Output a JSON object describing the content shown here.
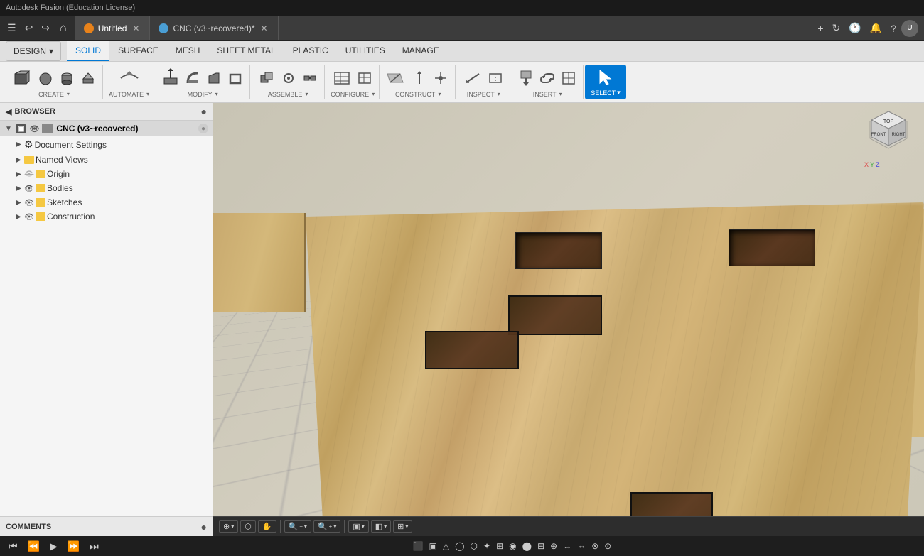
{
  "titlebar": {
    "text": "Autodesk Fusion (Education License)"
  },
  "tabs": [
    {
      "id": "untitled",
      "label": "Untitled",
      "icon_color": "orange",
      "active": true
    },
    {
      "id": "cnc",
      "label": "CNC (v3~recovered)*",
      "icon_color": "blue",
      "active": false
    }
  ],
  "tab_actions": [
    "+",
    "↻",
    "🕐",
    "🔔",
    "?"
  ],
  "ribbon": {
    "design_label": "DESIGN",
    "tabs": [
      "SOLID",
      "SURFACE",
      "MESH",
      "SHEET METAL",
      "PLASTIC",
      "UTILITIES",
      "MANAGE"
    ],
    "active_tab": "SOLID",
    "groups": [
      {
        "label": "CREATE",
        "has_arrow": true,
        "icons": [
          "⊞",
          "◻",
          "◯",
          "⬡"
        ]
      },
      {
        "label": "AUTOMATE",
        "has_arrow": true,
        "icons": [
          "✂"
        ]
      },
      {
        "label": "MODIFY",
        "has_arrow": true,
        "icons": [
          "◈",
          "◉",
          "▣",
          "⊟"
        ]
      },
      {
        "label": "ASSEMBLE",
        "has_arrow": true,
        "icons": [
          "⚙",
          "🔗",
          "📋"
        ]
      },
      {
        "label": "CONFIGURE",
        "has_arrow": true,
        "icons": [
          "⊞",
          "⊟"
        ]
      },
      {
        "label": "CONSTRUCT",
        "has_arrow": true,
        "icons": [
          "△",
          "⬡",
          "◈"
        ]
      },
      {
        "label": "INSPECT",
        "has_arrow": true,
        "icons": [
          "📐",
          "◉"
        ]
      },
      {
        "label": "INSERT",
        "has_arrow": true,
        "icons": [
          "↓",
          "🔗",
          "+"
        ]
      },
      {
        "label": "SELECT",
        "has_arrow": true,
        "is_active": true
      }
    ]
  },
  "browser": {
    "title": "BROWSER",
    "items": [
      {
        "id": "cnc-root",
        "label": "CNC (v3~recovered)",
        "level": 0,
        "type": "root",
        "expanded": true,
        "has_eye": true
      },
      {
        "id": "doc-settings",
        "label": "Document Settings",
        "level": 1,
        "type": "settings",
        "expanded": false,
        "has_eye": false
      },
      {
        "id": "named-views",
        "label": "Named Views",
        "level": 1,
        "type": "folder",
        "expanded": false,
        "has_eye": false
      },
      {
        "id": "origin",
        "label": "Origin",
        "level": 1,
        "type": "folder",
        "expanded": false,
        "has_eye": true
      },
      {
        "id": "bodies",
        "label": "Bodies",
        "level": 1,
        "type": "folder",
        "expanded": false,
        "has_eye": true
      },
      {
        "id": "sketches",
        "label": "Sketches",
        "level": 1,
        "type": "folder",
        "expanded": false,
        "has_eye": true
      },
      {
        "id": "construction",
        "label": "Construction",
        "level": 1,
        "type": "folder",
        "expanded": false,
        "has_eye": true
      }
    ]
  },
  "comments": {
    "label": "COMMENTS"
  },
  "viewport": {
    "bottom_tools": [
      {
        "label": "⊕",
        "type": "move"
      },
      {
        "label": "⬡",
        "type": "orbit"
      },
      {
        "label": "✋",
        "type": "pan"
      },
      {
        "label": "🔍-",
        "type": "zoom-out"
      },
      {
        "label": "🔍+",
        "type": "zoom-in"
      },
      {
        "label": "▣",
        "type": "view-mode"
      },
      {
        "label": "⊞",
        "type": "display"
      },
      {
        "label": "⋯",
        "type": "more"
      }
    ]
  },
  "statusbar": {
    "controls": [
      "⏮",
      "⏪",
      "▶",
      "⏩",
      "⏭"
    ]
  }
}
